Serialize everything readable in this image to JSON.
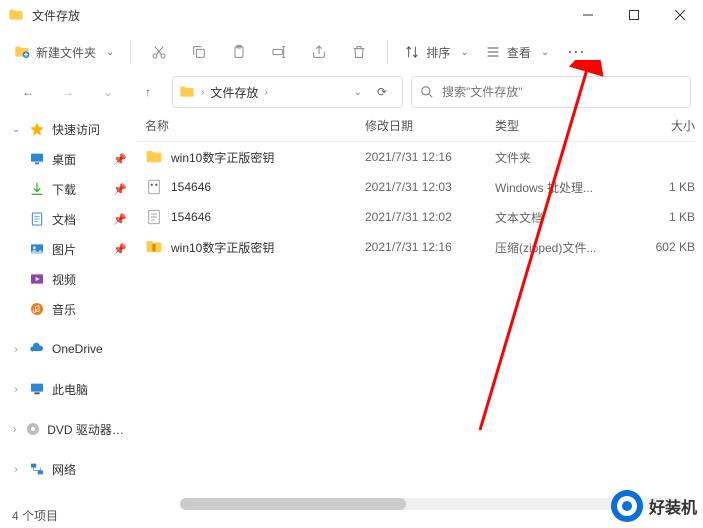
{
  "window": {
    "title": "文件存放"
  },
  "toolbar": {
    "new_folder": "新建文件夹",
    "sort": "排序",
    "view": "查看"
  },
  "address": {
    "crumbs": [
      "文件存放"
    ]
  },
  "search": {
    "placeholder": "搜索\"文件存放\""
  },
  "sidebar": {
    "quick_access": "快速访问",
    "items": [
      {
        "label": "桌面"
      },
      {
        "label": "下载"
      },
      {
        "label": "文档"
      },
      {
        "label": "图片"
      },
      {
        "label": "视频"
      },
      {
        "label": "音乐"
      }
    ],
    "onedrive": "OneDrive",
    "thispc": "此电脑",
    "dvd": "DVD 驱动器 (D:) CI",
    "network": "网络"
  },
  "columns": {
    "name": "名称",
    "date": "修改日期",
    "type": "类型",
    "size": "大小"
  },
  "files": [
    {
      "name": "win10数字正版密钥",
      "date": "2021/7/31 12:16",
      "type": "文件夹",
      "size": ""
    },
    {
      "name": "154646",
      "date": "2021/7/31 12:03",
      "type": "Windows 批处理...",
      "size": "1 KB"
    },
    {
      "name": "154646",
      "date": "2021/7/31 12:02",
      "type": "文本文档",
      "size": "1 KB"
    },
    {
      "name": "win10数字正版密钥",
      "date": "2021/7/31 12:16",
      "type": "压缩(zipped)文件...",
      "size": "602 KB"
    }
  ],
  "status": {
    "count": "4 个项目"
  },
  "watermark": {
    "text": "好装机"
  }
}
